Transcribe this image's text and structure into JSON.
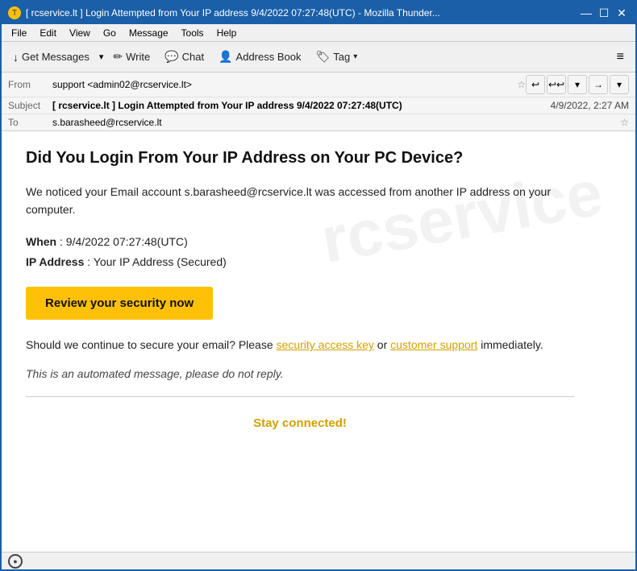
{
  "window": {
    "title": "[ rcservice.lt ] Login Attempted from Your IP address 9/4/2022 07:27:48(UTC) - Mozilla Thunder...",
    "icon": "T"
  },
  "title_controls": {
    "minimize": "—",
    "maximize": "☐",
    "close": "✕"
  },
  "menu": {
    "items": [
      "File",
      "Edit",
      "View",
      "Go",
      "Message",
      "Tools",
      "Help"
    ]
  },
  "toolbar": {
    "get_messages_label": "Get Messages",
    "dropdown_arrow": "▾",
    "write_label": "Write",
    "chat_label": "Chat",
    "address_book_label": "Address Book",
    "tag_label": "Tag",
    "hamburger": "≡"
  },
  "email_header": {
    "from_label": "From",
    "from_value": "support <admin02@rcservice.lt>",
    "subject_label": "Subject",
    "subject_value": "[ rcservice.lt ] Login Attempted from Your IP address 9/4/2022 07:27:48(UTC)",
    "date_value": "4/9/2022, 2:27 AM",
    "to_label": "To",
    "to_value": "s.barasheed@rcservice.lt",
    "nav": {
      "back": "↩",
      "reply_all": "↩↩",
      "down": "▾",
      "forward": "→",
      "more": "▾"
    }
  },
  "email_body": {
    "title": "Did You Login From Your IP Address on Your PC Device?",
    "para1": "We noticed your Email account s.barasheed@rcservice.lt was accessed from another IP address on your computer.",
    "when_label": "When",
    "when_value": ": 9/4/2022 07:27:48(UTC)",
    "ip_label": "IP Address",
    "ip_value": ": Your IP Address (Secured)",
    "cta_button": "Review your security now",
    "para2_prefix": "Should we continue to secure your email? Please",
    "para2_link1": "security access key",
    "para2_middle": " or ",
    "para2_link2": "customer support",
    "para2_suffix": "immediately.",
    "automated_msg": "This is an automated message, please do not reply.",
    "stay_connected": "Stay connected!"
  },
  "status_bar": {
    "icon": "((·))"
  },
  "colors": {
    "titlebar_bg": "#1a5fa8",
    "cta_bg": "#ffc107",
    "link_color": "#d4a000",
    "stay_connected_color": "#d4a000"
  }
}
